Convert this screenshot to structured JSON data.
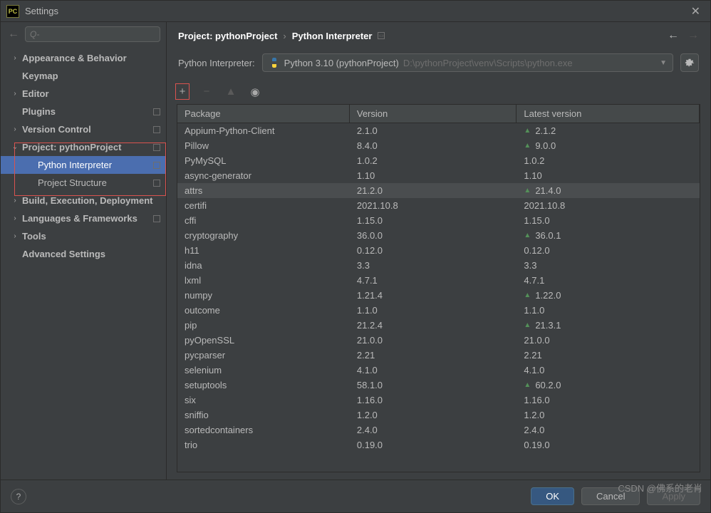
{
  "titlebar": {
    "title": "Settings"
  },
  "search": {
    "placeholder": "Q-"
  },
  "tree": [
    {
      "label": "Appearance & Behavior",
      "chev": "›",
      "bold": true
    },
    {
      "label": "Keymap",
      "chev": "",
      "bold": true
    },
    {
      "label": "Editor",
      "chev": "›",
      "bold": true
    },
    {
      "label": "Plugins",
      "chev": "",
      "bold": true,
      "marker": true
    },
    {
      "label": "Version Control",
      "chev": "›",
      "bold": true,
      "marker": true
    },
    {
      "label": "Project: pythonProject",
      "chev": "⌄",
      "bold": true,
      "marker": true
    },
    {
      "label": "Python Interpreter",
      "chev": "",
      "child": true,
      "selected": true,
      "marker": true
    },
    {
      "label": "Project Structure",
      "chev": "",
      "child": true,
      "marker": true
    },
    {
      "label": "Build, Execution, Deployment",
      "chev": "›",
      "bold": true
    },
    {
      "label": "Languages & Frameworks",
      "chev": "›",
      "bold": true,
      "marker": true
    },
    {
      "label": "Tools",
      "chev": "›",
      "bold": true
    },
    {
      "label": "Advanced Settings",
      "chev": "",
      "bold": true
    }
  ],
  "breadcrumb": {
    "a": "Project: pythonProject",
    "b": "Python Interpreter"
  },
  "interpreter": {
    "label": "Python Interpreter:",
    "name": "Python 3.10 (pythonProject)",
    "path": "D:\\pythonProject\\venv\\Scripts\\python.exe"
  },
  "columns": {
    "package": "Package",
    "version": "Version",
    "latest": "Latest version"
  },
  "packages": [
    {
      "name": "Appium-Python-Client",
      "version": "2.1.0",
      "latest": "2.1.2",
      "up": true
    },
    {
      "name": "Pillow",
      "version": "8.4.0",
      "latest": "9.0.0",
      "up": true
    },
    {
      "name": "PyMySQL",
      "version": "1.0.2",
      "latest": "1.0.2"
    },
    {
      "name": "async-generator",
      "version": "1.10",
      "latest": "1.10"
    },
    {
      "name": "attrs",
      "version": "21.2.0",
      "latest": "21.4.0",
      "up": true,
      "hover": true
    },
    {
      "name": "certifi",
      "version": "2021.10.8",
      "latest": "2021.10.8"
    },
    {
      "name": "cffi",
      "version": "1.15.0",
      "latest": "1.15.0"
    },
    {
      "name": "cryptography",
      "version": "36.0.0",
      "latest": "36.0.1",
      "up": true
    },
    {
      "name": "h11",
      "version": "0.12.0",
      "latest": "0.12.0"
    },
    {
      "name": "idna",
      "version": "3.3",
      "latest": "3.3"
    },
    {
      "name": "lxml",
      "version": "4.7.1",
      "latest": "4.7.1"
    },
    {
      "name": "numpy",
      "version": "1.21.4",
      "latest": "1.22.0",
      "up": true
    },
    {
      "name": "outcome",
      "version": "1.1.0",
      "latest": "1.1.0"
    },
    {
      "name": "pip",
      "version": "21.2.4",
      "latest": "21.3.1",
      "up": true
    },
    {
      "name": "pyOpenSSL",
      "version": "21.0.0",
      "latest": "21.0.0"
    },
    {
      "name": "pycparser",
      "version": "2.21",
      "latest": "2.21"
    },
    {
      "name": "selenium",
      "version": "4.1.0",
      "latest": "4.1.0"
    },
    {
      "name": "setuptools",
      "version": "58.1.0",
      "latest": "60.2.0",
      "up": true
    },
    {
      "name": "six",
      "version": "1.16.0",
      "latest": "1.16.0"
    },
    {
      "name": "sniffio",
      "version": "1.2.0",
      "latest": "1.2.0"
    },
    {
      "name": "sortedcontainers",
      "version": "2.4.0",
      "latest": "2.4.0"
    },
    {
      "name": "trio",
      "version": "0.19.0",
      "latest": "0.19.0"
    }
  ],
  "buttons": {
    "ok": "OK",
    "cancel": "Cancel",
    "apply": "Apply"
  },
  "watermark": "CSDN @佛系的老肖"
}
